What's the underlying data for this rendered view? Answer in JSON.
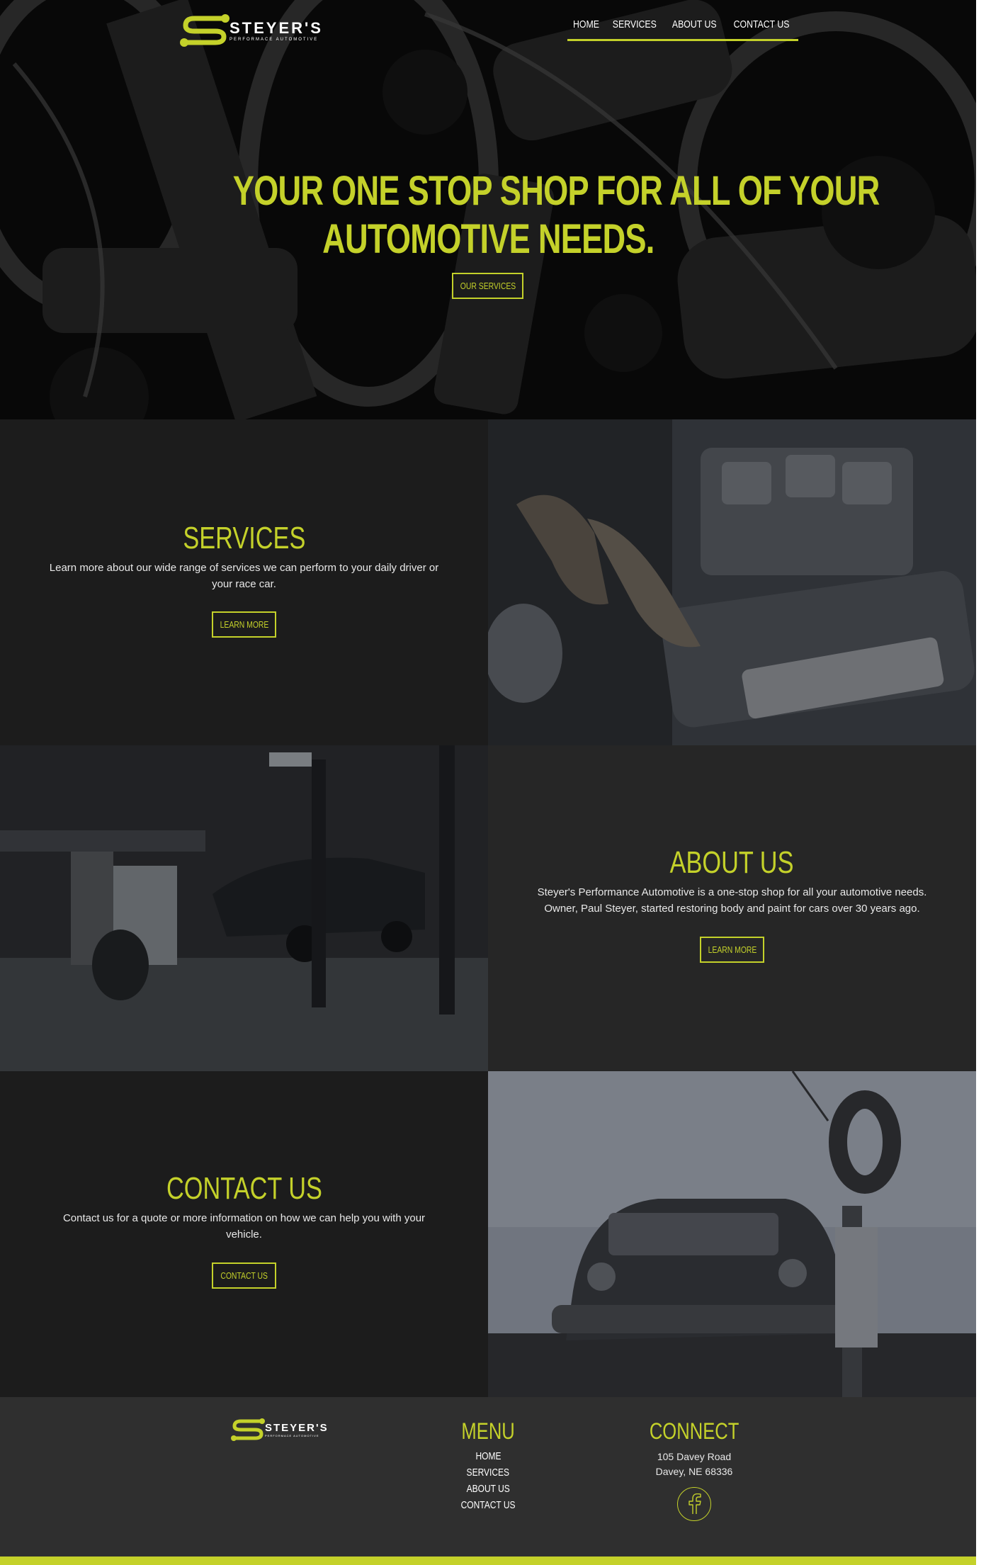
{
  "brand": {
    "name": "STEYER'S",
    "tagline": "PERFORMACE AUTOMOTIVE",
    "accent_color": "#c4d12a"
  },
  "nav": {
    "items": [
      "HOME",
      "SERVICES",
      "ABOUT US",
      "CONTACT US"
    ]
  },
  "hero": {
    "title_line1": "YOUR ONE STOP SHOP FOR ALL OF YOUR",
    "title_line2": "AUTOMOTIVE NEEDS.",
    "button": "OUR SERVICES"
  },
  "services": {
    "heading": "SERVICES",
    "text": "Learn more about our wide range of services we can perform to your daily driver or your race car.",
    "button": "LEARN MORE"
  },
  "about": {
    "heading": "ABOUT US",
    "text": "Steyer's Performance Automotive is a one-stop shop for all your automotive needs. Owner, Paul Steyer, started restoring body and paint for cars over 30 years ago.",
    "button": "LEARN MORE"
  },
  "contact": {
    "heading": "CONTACT US",
    "text": "Contact us for a quote or more information on how we can help you with your vehicle.",
    "button": "CONTACT US"
  },
  "footer": {
    "menu_heading": "MENU",
    "menu_items": [
      "HOME",
      "SERVICES",
      "ABOUT US",
      "CONTACT US"
    ],
    "connect_heading": "CONNECT",
    "address_line1": "105 Davey Road",
    "address_line2": "Davey, NE 68336",
    "social_icon": "facebook-icon"
  }
}
